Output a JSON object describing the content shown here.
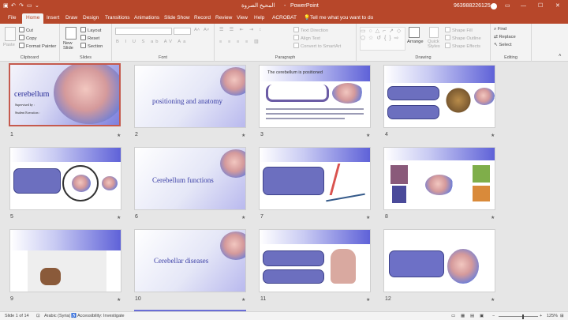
{
  "titlebar": {
    "file_name": "المحيخ الصروة",
    "separator": "-",
    "app_name": "PowerPoint",
    "account": "963988226125"
  },
  "tabs": [
    "File",
    "Home",
    "Insert",
    "Draw",
    "Design",
    "Transitions",
    "Animations",
    "Slide Show",
    "Record",
    "Review",
    "View",
    "Help",
    "ACROBAT"
  ],
  "tell_me": "Tell me what you want to do",
  "ribbon": {
    "clipboard": {
      "paste": "Paste",
      "cut": "Cut",
      "copy": "Copy",
      "format_painter": "Format Painter",
      "label": "Clipboard"
    },
    "slides": {
      "new_slide": "New Slide",
      "layout": "Layout",
      "reset": "Reset",
      "section": "Section",
      "label": "Slides"
    },
    "font": {
      "label": "Font"
    },
    "paragraph": {
      "text_direction": "Text Direction",
      "align_text": "Align Text",
      "convert_smartart": "Convert to SmartArt",
      "label": "Paragraph"
    },
    "drawing": {
      "arrange": "Arrange",
      "quick_styles": "Quick Styles",
      "shape_fill": "Shape Fill",
      "shape_outline": "Shape Outline",
      "shape_effects": "Shape Effects",
      "label": "Drawing"
    },
    "editing": {
      "find": "Find",
      "replace": "Replace",
      "select": "Select",
      "label": "Editing"
    }
  },
  "slides": [
    {
      "num": "1",
      "title": "cerebellum",
      "sub1": "Supervised by :",
      "sub2": "Student Execution :"
    },
    {
      "num": "2",
      "title": "positioning and anatomy"
    },
    {
      "num": "3",
      "title": "The cerebellum is positioned"
    },
    {
      "num": "4"
    },
    {
      "num": "5"
    },
    {
      "num": "6",
      "title": "Cerebellum functions"
    },
    {
      "num": "7"
    },
    {
      "num": "8"
    },
    {
      "num": "9"
    },
    {
      "num": "10",
      "title": "Cerebellar diseases"
    },
    {
      "num": "11"
    },
    {
      "num": "12"
    }
  ],
  "star": "★",
  "status": {
    "slide_count": "Slide 1 of 14",
    "language": "Arabic (Syria)",
    "accessibility": "Accessibility: Investigate",
    "zoom": "125%"
  },
  "colors": {
    "accent": "#b7472a",
    "slide_blue": "#3b3fa6",
    "selected_border": "#c55a4e"
  }
}
